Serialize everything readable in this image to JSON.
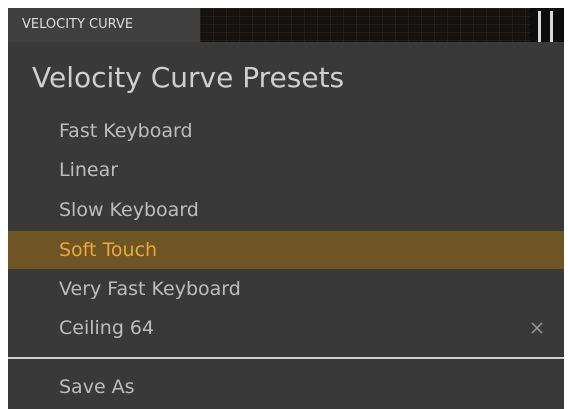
{
  "header": {
    "tab_label": "VELOCITY CURVE"
  },
  "menu": {
    "title": "Velocity Curve Presets",
    "items": [
      {
        "label": "Fast Keyboard",
        "selected": false,
        "deletable": false
      },
      {
        "label": "Linear",
        "selected": false,
        "deletable": false
      },
      {
        "label": "Slow Keyboard",
        "selected": false,
        "deletable": false
      },
      {
        "label": "Soft Touch",
        "selected": true,
        "deletable": false
      },
      {
        "label": "Very Fast Keyboard",
        "selected": false,
        "deletable": false
      },
      {
        "label": "Ceiling 64",
        "selected": false,
        "deletable": true
      }
    ],
    "save_as_label": "Save As"
  },
  "icons": {
    "delete": "close-icon"
  },
  "colors": {
    "menu_background": "#393939",
    "selected_background": "#6f5424",
    "selected_text": "#e9a93a",
    "item_text": "#bdbdbd",
    "title_text": "#cfcfcf"
  }
}
